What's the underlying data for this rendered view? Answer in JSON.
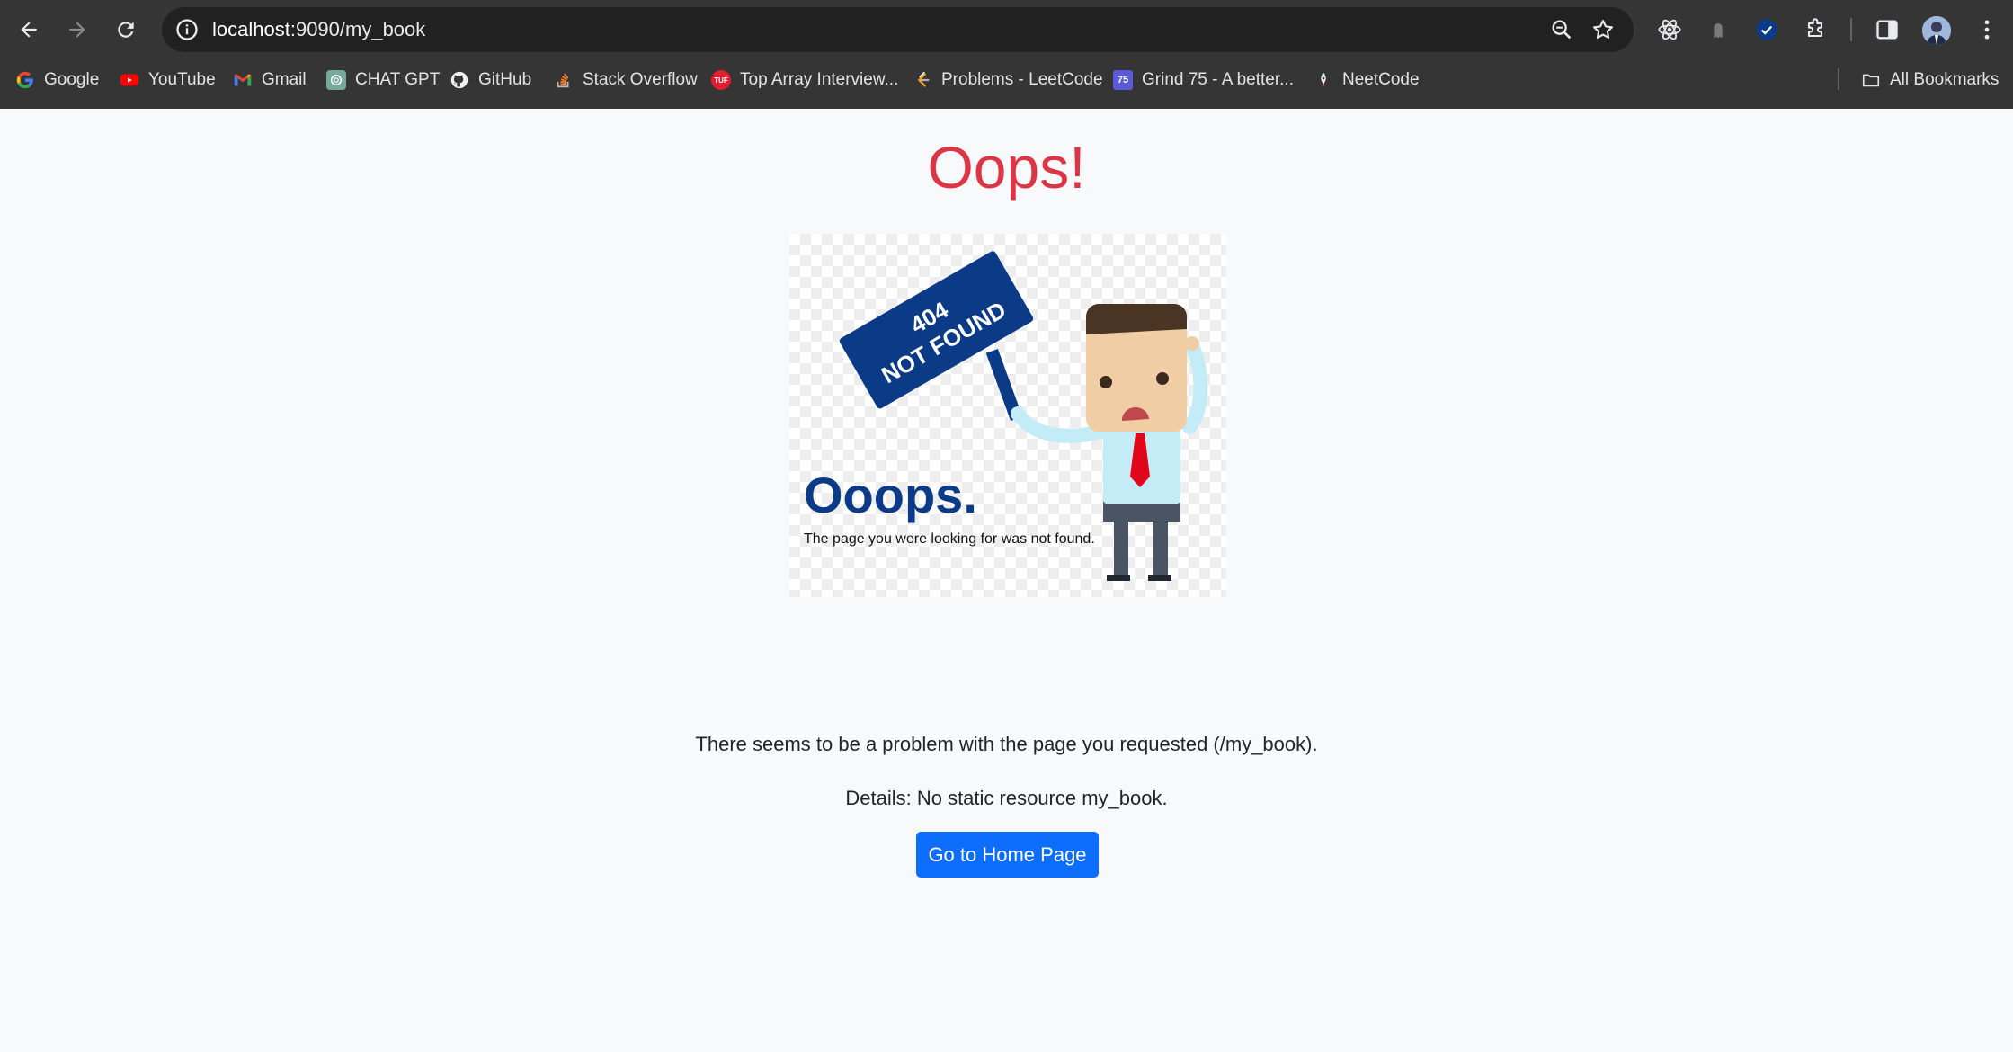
{
  "browser": {
    "url_host": "localhost",
    "url_rest": ":9090/my_book",
    "bookmarks": [
      {
        "label": "Google",
        "icon": "google-icon"
      },
      {
        "label": "YouTube",
        "icon": "youtube-icon"
      },
      {
        "label": "Gmail",
        "icon": "gmail-icon"
      },
      {
        "label": "CHAT GPT",
        "icon": "chatgpt-icon"
      },
      {
        "label": "GitHub",
        "icon": "github-icon"
      },
      {
        "label": "Stack Overflow",
        "icon": "stackoverflow-icon"
      },
      {
        "label": "Top Array Interview...",
        "icon": "tuf-icon"
      },
      {
        "label": "Problems - LeetCode",
        "icon": "leetcode-icon"
      },
      {
        "label": "Grind 75 - A better...",
        "icon": "grind75-icon"
      },
      {
        "label": "NeetCode",
        "icon": "neetcode-icon"
      }
    ],
    "all_bookmarks": "All Bookmarks",
    "fav_text": {
      "tuf": "TUF",
      "grind": "75"
    }
  },
  "page": {
    "title": "Oops!",
    "illustration": {
      "sign_line1": "404",
      "sign_line2": "NOT FOUND",
      "headline": "Ooops.",
      "caption": "The page you were looking for was not found."
    },
    "message": "There seems to be a problem with the page you requested (/my_book).",
    "details": "Details: No static resource my_book.",
    "home_button": "Go to Home Page"
  },
  "colors": {
    "title": "#dc3545",
    "button": "#0d6efd",
    "chrome": "#353535",
    "sign": "#0b3a86"
  }
}
